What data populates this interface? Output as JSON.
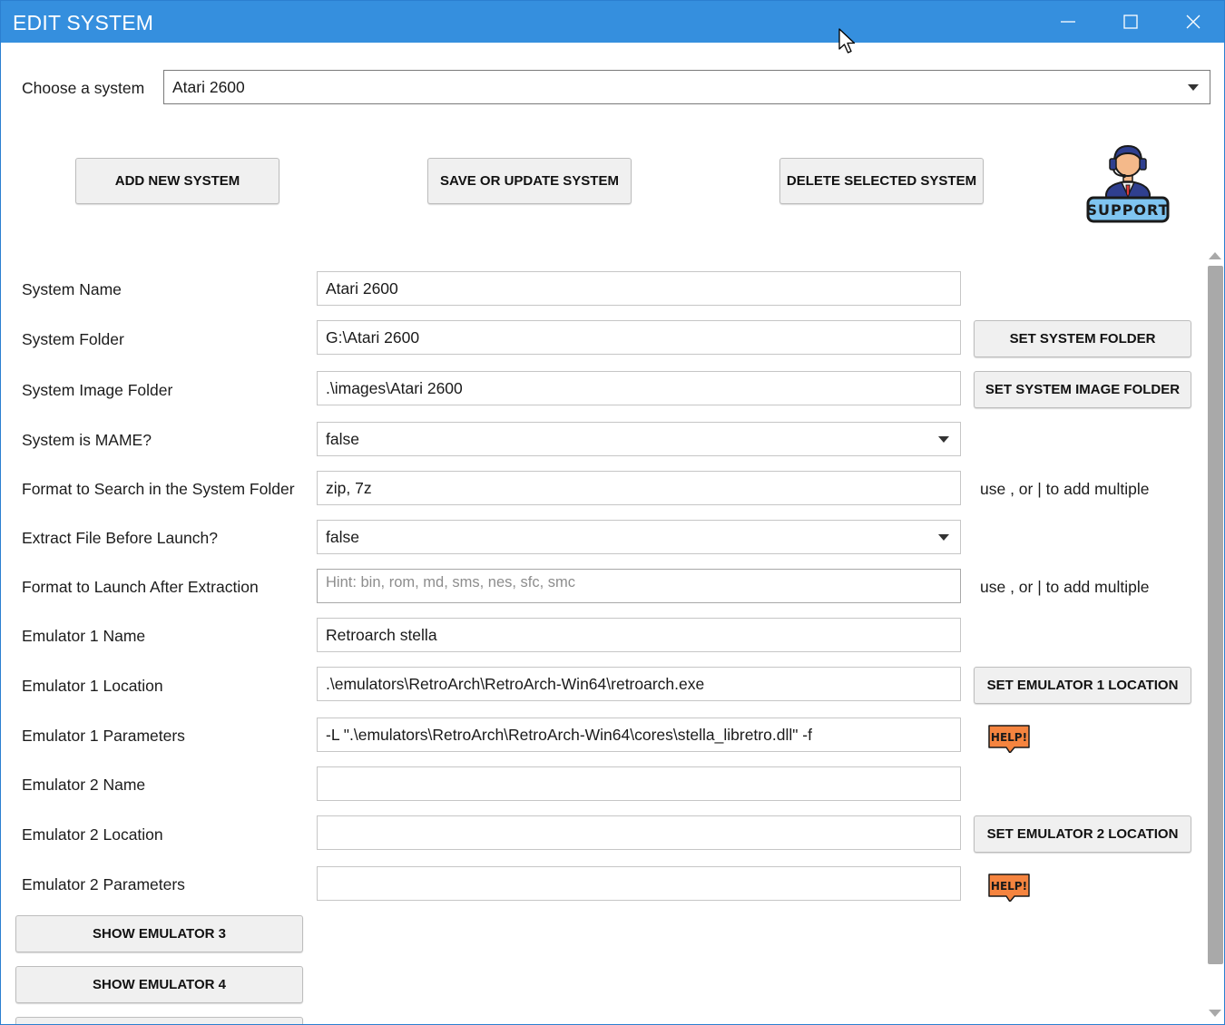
{
  "window": {
    "title": "EDIT SYSTEM"
  },
  "chooser": {
    "label": "Choose a system",
    "value": "Atari 2600"
  },
  "actions": {
    "add_label": "ADD NEW SYSTEM",
    "save_label": "SAVE OR UPDATE SYSTEM",
    "delete_label": "DELETE SELECTED SYSTEM",
    "support_label": "SUPPORT"
  },
  "form": {
    "system_name": {
      "label": "System Name",
      "value": "Atari 2600"
    },
    "system_folder": {
      "label": "System Folder",
      "value": "G:\\Atari 2600",
      "button": "SET SYSTEM FOLDER"
    },
    "image_folder": {
      "label": "System Image Folder",
      "value": ".\\images\\Atari 2600",
      "button": "SET SYSTEM IMAGE FOLDER"
    },
    "is_mame": {
      "label": "System is MAME?",
      "value": "false"
    },
    "format_search": {
      "label": "Format to Search in the System Folder",
      "value": "zip, 7z",
      "note": "use , or | to add multiple"
    },
    "extract": {
      "label": "Extract File Before Launch?",
      "value": "false"
    },
    "format_launch": {
      "label": "Format to Launch After Extraction",
      "placeholder": "Hint: bin, rom, md, sms, nes, sfc, smc",
      "note": "use , or | to add multiple"
    },
    "emu1_name": {
      "label": "Emulator 1 Name",
      "value": "Retroarch stella"
    },
    "emu1_location": {
      "label": "Emulator 1 Location",
      "value": ".\\emulators\\RetroArch\\RetroArch-Win64\\retroarch.exe",
      "button": "SET EMULATOR 1 LOCATION"
    },
    "emu1_params": {
      "label": "Emulator 1 Parameters",
      "value": "-L \".\\emulators\\RetroArch\\RetroArch-Win64\\cores\\stella_libretro.dll\" -f",
      "help": "HELP!"
    },
    "emu2_name": {
      "label": "Emulator 2 Name",
      "value": ""
    },
    "emu2_location": {
      "label": "Emulator 2 Location",
      "value": "",
      "button": "SET EMULATOR 2 LOCATION"
    },
    "emu2_params": {
      "label": "Emulator 2 Parameters",
      "value": "",
      "help": "HELP!"
    }
  },
  "more": {
    "show3": "SHOW EMULATOR 3",
    "show4": "SHOW EMULATOR 4"
  },
  "colors": {
    "titlebar": "#358fde",
    "help_badge": "#f5843f",
    "support_blue": "#2f3f8f"
  }
}
